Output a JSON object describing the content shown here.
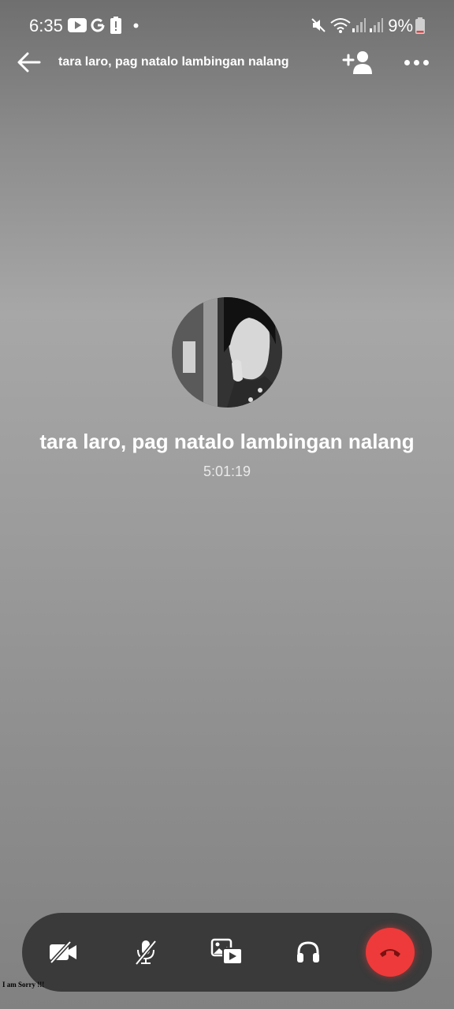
{
  "status_bar": {
    "time": "6:35",
    "battery_percent": "9%",
    "icons": [
      "youtube-icon",
      "google-icon",
      "battery-alert-icon",
      "dot-icon",
      "mute-icon",
      "wifi-icon",
      "signal-icon",
      "signal-icon",
      "battery-icon"
    ]
  },
  "header": {
    "title": "tara laro, pag natalo lambingan nalang",
    "back_icon": "arrow-left-icon",
    "add_person_icon": "add-person-icon",
    "more_icon": "more-horizontal-icon"
  },
  "call": {
    "name": "tara laro, pag natalo lambingan nalang",
    "timer": "5:01:19"
  },
  "controls": {
    "items": [
      "video-off-icon",
      "mic-off-icon",
      "share-screen-icon",
      "headphones-icon",
      "end-call-icon"
    ],
    "end_call_color": "#ee3a3a"
  },
  "watermark": "I am Sorry !!!"
}
